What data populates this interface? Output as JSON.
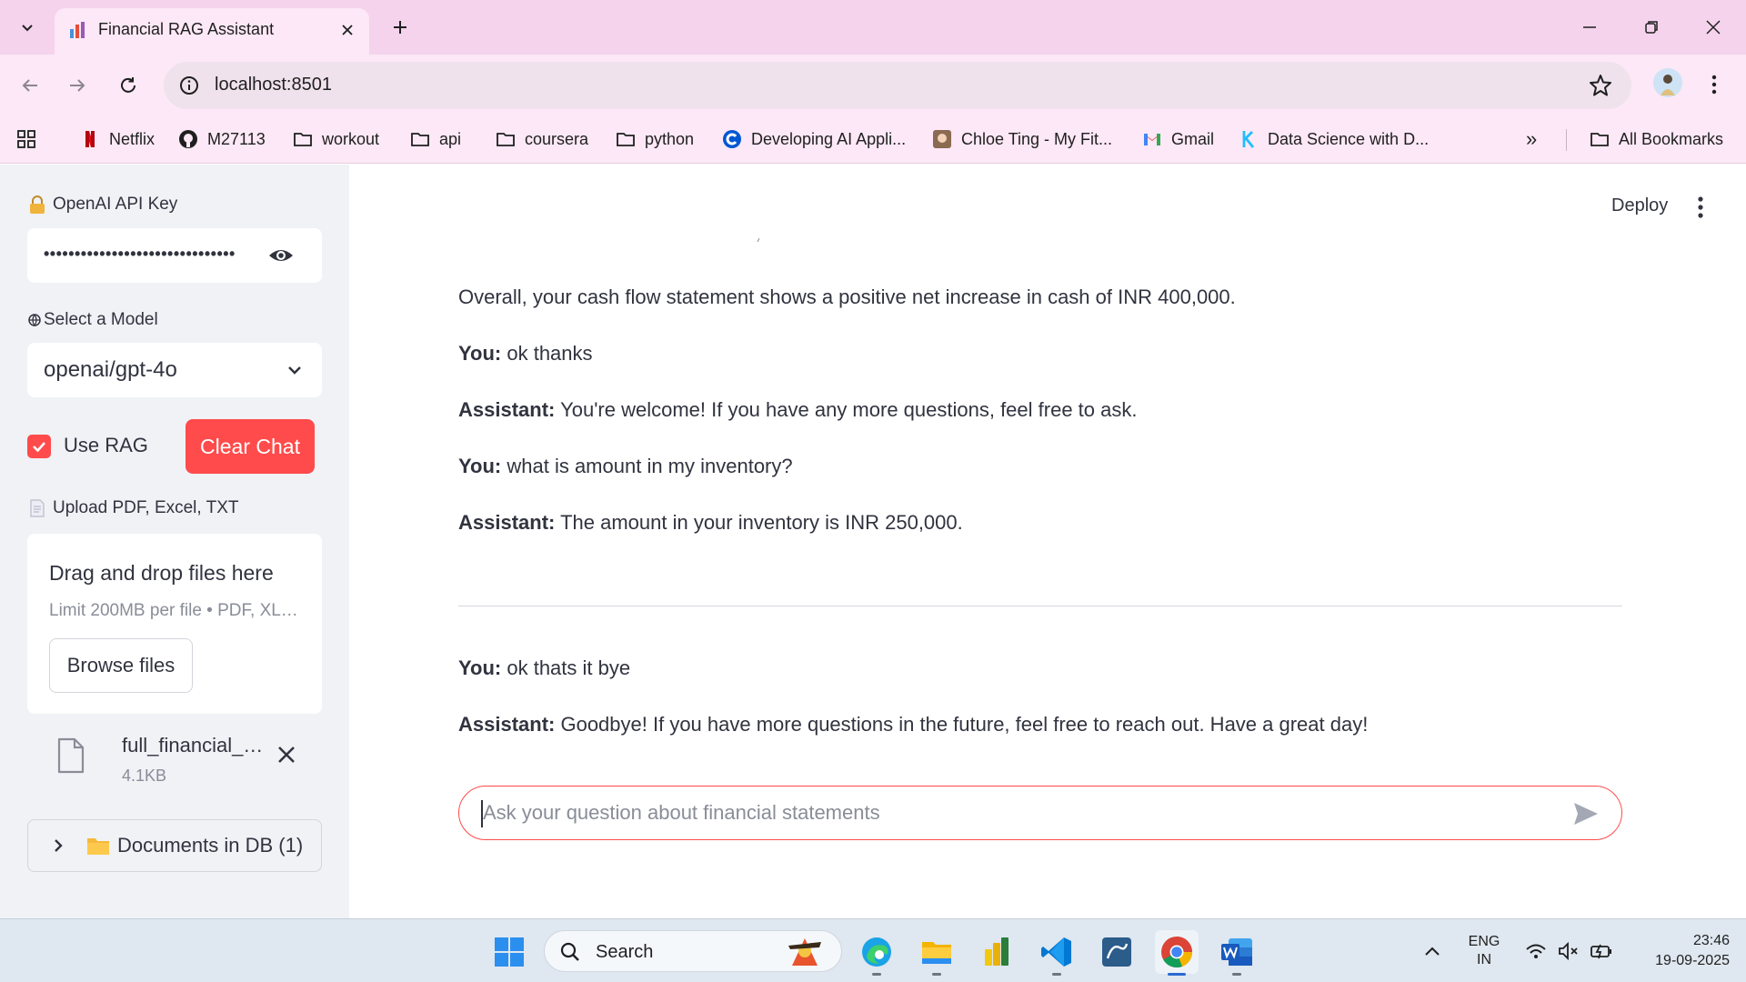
{
  "browser": {
    "tab_title": "Financial RAG Assistant",
    "url": "localhost:8501",
    "bookmarks": [
      {
        "label": "Netflix",
        "icon": "netflix-icon"
      },
      {
        "label": "M27113",
        "icon": "github-icon"
      },
      {
        "label": "workout",
        "icon": "folder-icon"
      },
      {
        "label": "api",
        "icon": "folder-icon"
      },
      {
        "label": "coursera",
        "icon": "folder-icon"
      },
      {
        "label": "python",
        "icon": "folder-icon"
      },
      {
        "label": "Developing AI Appli...",
        "icon": "coursera-icon"
      },
      {
        "label": "Chloe Ting - My Fit...",
        "icon": "avatar-icon"
      },
      {
        "label": "Gmail",
        "icon": "gmail-icon"
      },
      {
        "label": "Data Science with D...",
        "icon": "kaggle-icon"
      }
    ],
    "all_bookmarks": "All Bookmarks",
    "more_bookmarks": "»"
  },
  "sidebar": {
    "api_key_label": "OpenAI API Key",
    "api_key_masked": "•••••••••••••••••••••••••••••••",
    "model_label": "Select a Model",
    "model_value": "openai/gpt-4o",
    "use_rag_label": "Use RAG",
    "use_rag_checked": true,
    "clear_chat_label": "Clear Chat",
    "upload_label": "Upload PDF, Excel, TXT",
    "uploader_title": "Drag and drop files here",
    "uploader_limit": "Limit 200MB per file • PDF, XL…",
    "browse_label": "Browse files",
    "file_name": "full_financial_…",
    "file_size": "4.1KB",
    "documents_label": "Documents in DB (1)"
  },
  "main": {
    "deploy_label": "Deploy",
    "messages_top": [
      {
        "speaker": "",
        "text": "Overall, your cash flow statement shows a positive net increase in cash of INR 400,000."
      },
      {
        "speaker": "You:",
        "text": " ok thanks"
      },
      {
        "speaker": "Assistant:",
        "text": " You're welcome! If you have any more questions, feel free to ask."
      },
      {
        "speaker": "You:",
        "text": " what is amount in my inventory?"
      },
      {
        "speaker": "Assistant:",
        "text": " The amount in your inventory is INR 250,000."
      }
    ],
    "messages_bottom": [
      {
        "speaker": "You:",
        "text": " ok thats it bye"
      },
      {
        "speaker": "Assistant:",
        "text": " Goodbye! If you have more questions in the future, feel free to reach out. Have a great day!"
      }
    ],
    "chat_placeholder": "Ask your question about financial statements"
  },
  "taskbar": {
    "search_label": "Search",
    "lang_top": "ENG",
    "lang_bottom": "IN",
    "time": "23:46",
    "date": "19-09-2025"
  },
  "colors": {
    "accent": "#ff4b4b",
    "sidebar_bg": "#f0f2f6",
    "chrome_tabbar": "#f5d3ec",
    "chrome_toolbar": "#fce8f6"
  }
}
